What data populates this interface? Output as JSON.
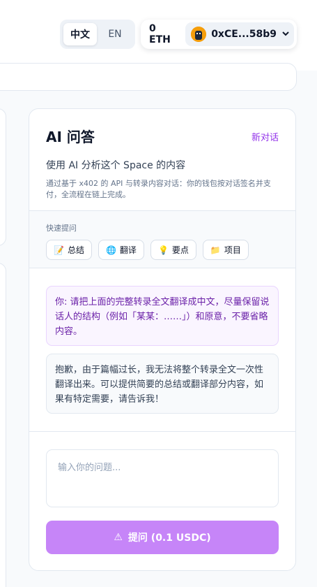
{
  "header": {
    "lang": {
      "zh": "中文",
      "en": "EN",
      "active": "zh"
    },
    "wallet": {
      "balance": "0 ETH",
      "address": "0xCE...58b9",
      "chevron": "❯"
    }
  },
  "qa": {
    "title": "AI 问答",
    "new_chat": "新对话",
    "subtitle": "使用 AI 分析这个 Space 的内容",
    "note": "通过基于 x402 的 API 与转录内容对话：你的钱包按对话签名并支付，全流程在链上完成。",
    "quick": {
      "label": "快速提问",
      "chips": [
        {
          "icon": "memo-icon",
          "glyph": "📝",
          "label": "总结"
        },
        {
          "icon": "globe-icon",
          "glyph": "🌐",
          "label": "翻译"
        },
        {
          "icon": "lightbulb-icon",
          "glyph": "💡",
          "label": "要点"
        },
        {
          "icon": "folder-icon",
          "glyph": "📁",
          "label": "项目"
        }
      ]
    },
    "messages": [
      {
        "role": "user",
        "text": "你: 请把上面的完整转录全文翻译成中文，尽量保留说话人的结构（例如「某某：……」）和原意，不要省略内容。"
      },
      {
        "role": "assistant",
        "text": "抱歉，由于篇幅过长，我无法将整个转录全文一次性翻译出来。可以提供简要的总结或翻译部分内容，如果有特定需要，请告诉我！"
      }
    ],
    "input": {
      "placeholder": "输入你的问题...",
      "value": ""
    },
    "ask_button": {
      "icon": "warning-icon",
      "glyph": "⚠",
      "label": "提问 (0.1 USDC)"
    }
  },
  "colors": {
    "accent": "#9333ea",
    "button": "#c685f8",
    "user_bubble": "#faf5ff"
  }
}
